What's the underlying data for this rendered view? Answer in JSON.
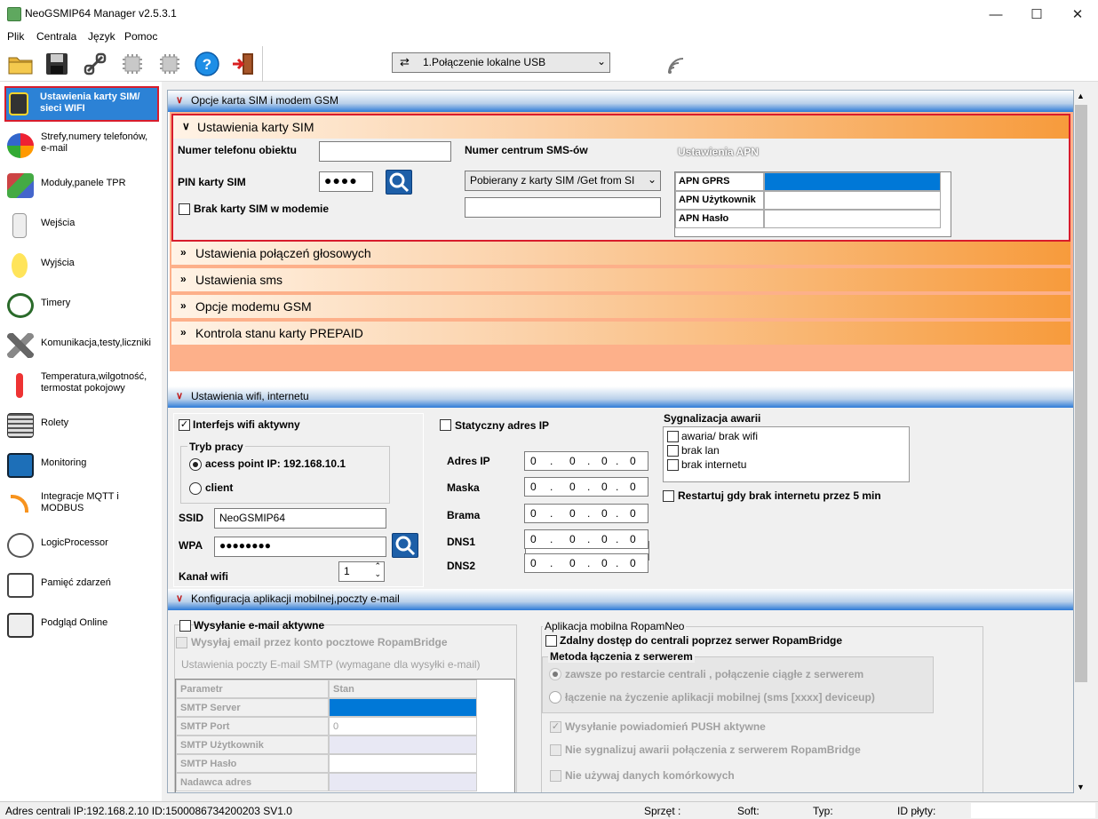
{
  "app": {
    "title": "NeoGSMIP64 Manager v2.5.3.1"
  },
  "menu": [
    "Plik",
    "Centrala",
    "Język",
    "Pomoc"
  ],
  "connection": {
    "label": "1.Połączenie lokalne USB"
  },
  "sidebar": {
    "items": [
      {
        "label": "Ustawienia karty SIM/ sieci WIFI"
      },
      {
        "label": "Strefy,numery telefonów, e-mail"
      },
      {
        "label": "Moduły,panele TPR"
      },
      {
        "label": "Wejścia"
      },
      {
        "label": "Wyjścia"
      },
      {
        "label": "Timery"
      },
      {
        "label": "Komunikacja,testy,liczniki"
      },
      {
        "label": "Temperatura,wilgotność, termostat pokojowy"
      },
      {
        "label": "Rolety"
      },
      {
        "label": "Monitoring"
      },
      {
        "label": "Integracje MQTT i MODBUS"
      },
      {
        "label": "LogicProcessor"
      },
      {
        "label": "Pamięć zdarzeń"
      },
      {
        "label": "Podgląd Online"
      }
    ]
  },
  "gsm": {
    "band": "Opcje karta SIM i modem GSM",
    "sim_header": "Ustawienia karty SIM",
    "phone_label": "Numer telefonu obiektu",
    "phone_value": "",
    "pin_label": "PIN karty SIM",
    "pin_value": "●●●●",
    "nosim_label": "Brak karty SIM w modemie",
    "sms_center_label": "Numer centrum SMS-ów",
    "sms_center_select": "Pobierany z karty SIM /Get from SI",
    "apn_title": "Ustawienia APN",
    "apn_rows": [
      "APN GPRS",
      "APN Użytkownik",
      "APN Hasło"
    ],
    "sections": [
      "Ustawienia połączeń głosowych",
      "Ustawienia sms",
      "Opcje modemu GSM",
      "Kontrola stanu karty PREPAID"
    ]
  },
  "wifi": {
    "band": "Ustawienia wifi, internetu",
    "active_label": "Interfejs wifi aktywny",
    "mode_title": "Tryb pracy",
    "ap_label": "acess point IP: 192.168.10.1",
    "client_label": "client",
    "ssid_label": "SSID",
    "ssid_value": "NeoGSMIP64",
    "wpa_label": "WPA",
    "wpa_value": "●●●●●●●●",
    "channel_label": "Kanał wifi",
    "channel_value": "1",
    "static_label": "Statyczny adres IP",
    "ip_rows": [
      "Adres IP",
      "Maska",
      "Brama",
      "DNS1",
      "DNS2"
    ],
    "ip_octet": "0",
    "alarm_title": "Sygnalizacja awarii",
    "alarms": [
      "awaria/ brak wifi",
      "brak lan",
      "brak internetu"
    ],
    "restart_label": "Restartuj gdy brak internetu przez 5 min"
  },
  "mobile": {
    "band": "Konfiguracja aplikacji mobilnej,poczty e-mail",
    "email_active": "Wysyłanie e-mail aktywne",
    "email_bridge": "Wysyłaj email przez konto pocztowe RopamBridge",
    "smtp_title": "Ustawienia poczty E-mail SMTP (wymagane dla wysyłki e-mail)",
    "table_head": [
      "Parametr",
      "Stan"
    ],
    "table_rows": [
      {
        "p": "SMTP Server",
        "v": ""
      },
      {
        "p": "SMTP Port",
        "v": "0"
      },
      {
        "p": "SMTP Użytkownik",
        "v": ""
      },
      {
        "p": "SMTP Hasło",
        "v": ""
      },
      {
        "p": "Nadawca adres",
        "v": ""
      }
    ],
    "app_title": "Aplikacja mobilna RopamNeo",
    "remote_label": "Zdalny dostęp do centrali poprzez serwer RopamBridge",
    "method_title": "Metoda łączenia z serwerem",
    "method_1": "zawsze po restarcie centrali , połączenie ciągłe z serwerem",
    "method_2": "łączenie na życzenie aplikacji mobilnej  (sms [xxxx] deviceup)",
    "push_label": "Wysyłanie powiadomień PUSH aktywne",
    "nosignal_label": "Nie sygnalizuj awarii  połączenia z serwerem RopamBridge",
    "nocell_label": "Nie używaj danych komórkowych"
  },
  "status": {
    "left": "Adres centrali IP:192.168.2.10 ID:1500086734200203 SV1.0",
    "hw": "Sprzęt :",
    "soft": "Soft:",
    "type": "Typ:",
    "board": "ID płyty:"
  },
  "colors": {
    "accent": "#2c82d6",
    "highlight": "#d81c2c",
    "orange": "#f79b3c"
  }
}
